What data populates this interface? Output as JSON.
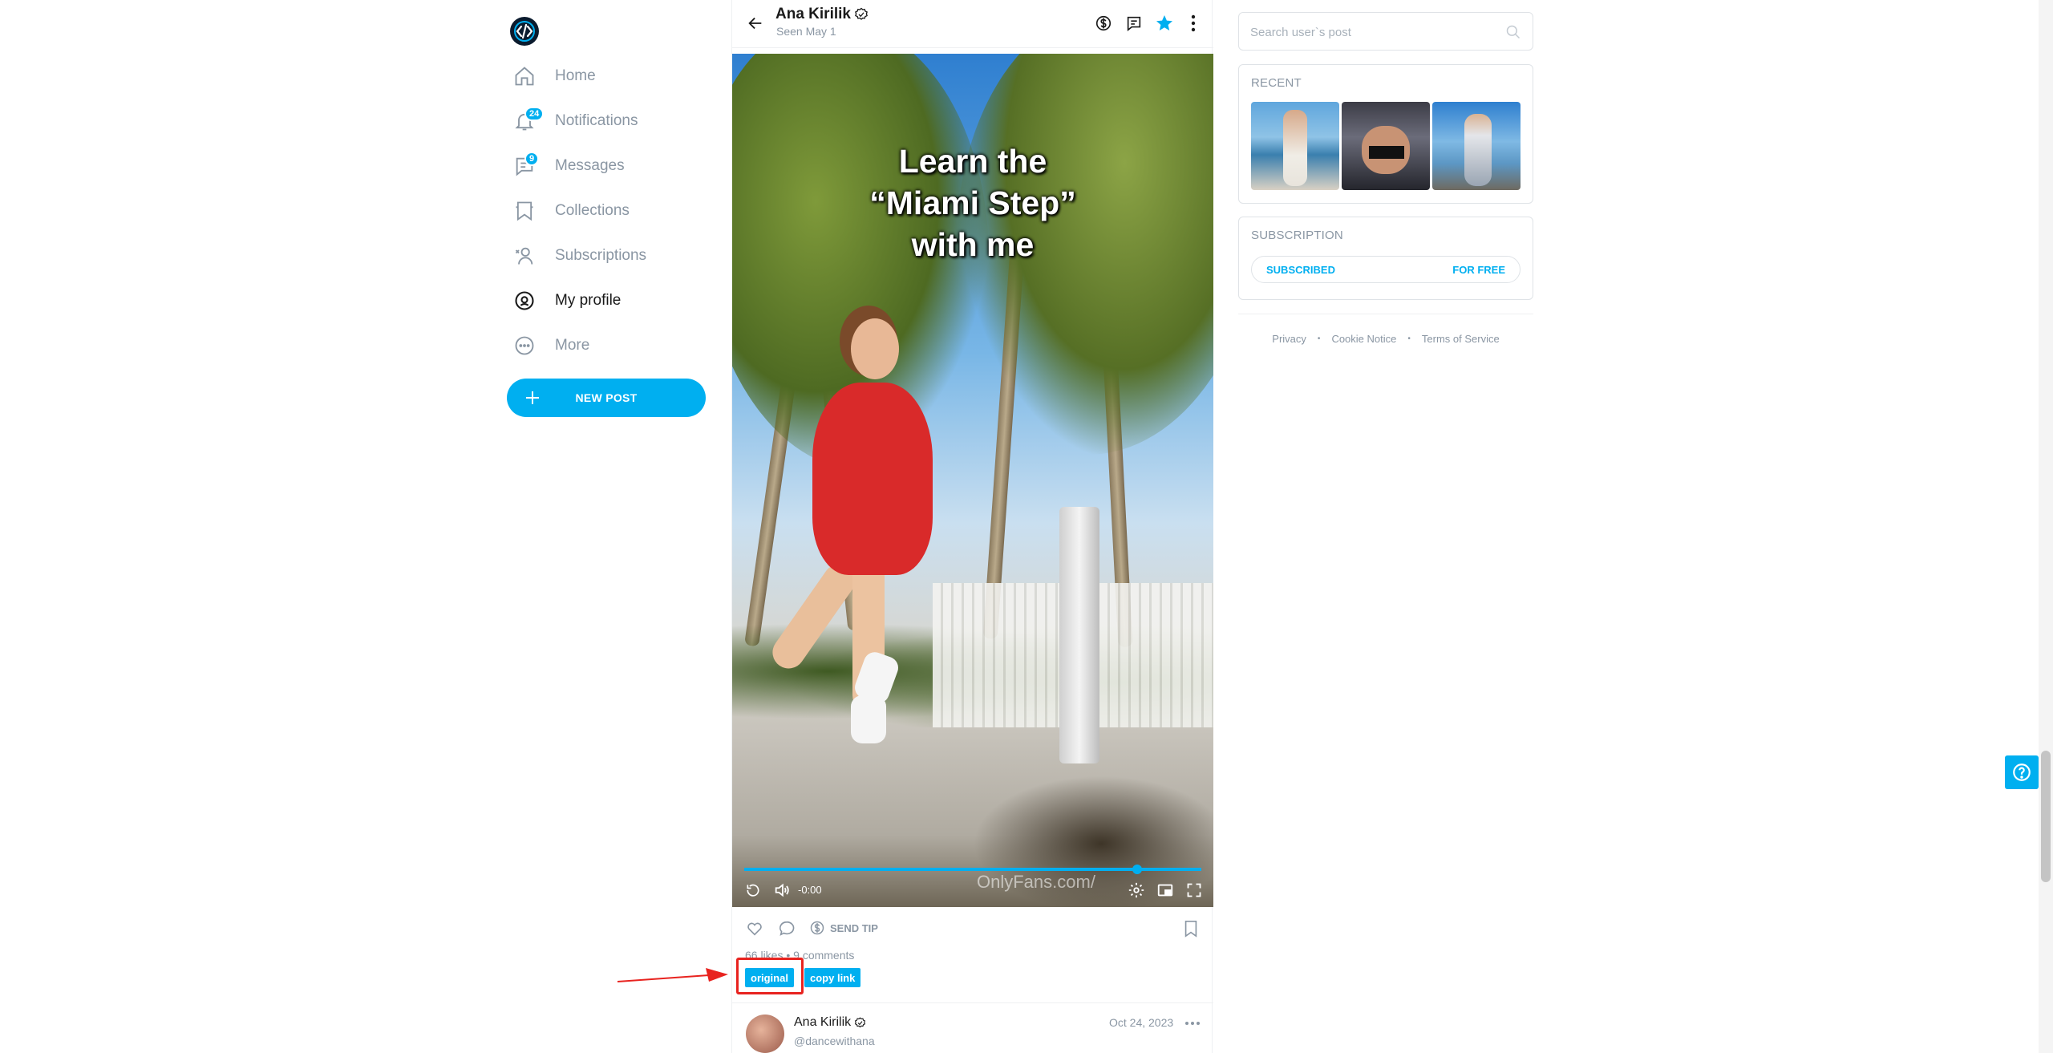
{
  "sidebar": {
    "items": [
      {
        "label": "Home",
        "icon": "home-icon"
      },
      {
        "label": "Notifications",
        "icon": "bell-icon",
        "badge": "24"
      },
      {
        "label": "Messages",
        "icon": "message-icon",
        "badge": "9"
      },
      {
        "label": "Collections",
        "icon": "bookmark-collection-icon"
      },
      {
        "label": "Subscriptions",
        "icon": "subscriptions-icon"
      },
      {
        "label": "My profile",
        "icon": "profile-icon"
      },
      {
        "label": "More",
        "icon": "more-circle-icon"
      }
    ],
    "new_post_label": "NEW POST"
  },
  "header": {
    "name": "Ana Kirilik",
    "seen": "Seen  May 1"
  },
  "video": {
    "caption_lines": [
      "Learn the",
      "“Miami Step”",
      "with me"
    ],
    "watermark": "OnlyFans.com/",
    "time": "-0:00",
    "progress": 0.86
  },
  "post": {
    "send_tip_label": "SEND TIP",
    "counts": "66 likes  •  9 comments",
    "tags": [
      "original",
      "copy link"
    ]
  },
  "comment": {
    "name": "Ana Kirilik",
    "handle": "@dancewithana",
    "date": "Oct 24, 2023"
  },
  "right": {
    "search_placeholder": "Search user`s post",
    "recent_title": "RECENT",
    "subscription_title": "SUBSCRIPTION",
    "subscribed_label": "SUBSCRIBED",
    "free_label": "FOR FREE",
    "footer": [
      "Privacy",
      "Cookie Notice",
      "Terms of Service"
    ]
  },
  "colors": {
    "accent": "#00aff0",
    "muted": "#8a96a3",
    "annotation": "#e8231f"
  }
}
